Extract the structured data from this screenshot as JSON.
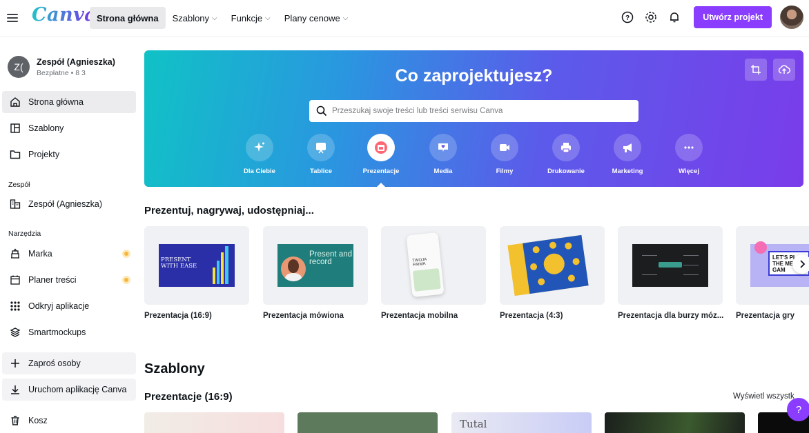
{
  "brand": {
    "logo": "Canva",
    "accent": "#8b3dff"
  },
  "topnav": {
    "items": [
      {
        "label": "Strona główna",
        "active": true
      },
      {
        "label": "Szablony",
        "caret": true
      },
      {
        "label": "Funkcje",
        "caret": true
      },
      {
        "label": "Plany cenowe",
        "caret": true
      }
    ],
    "create_label": "Utwórz projekt",
    "icons": [
      "help-icon",
      "gear-icon",
      "bell-icon"
    ]
  },
  "sidebar": {
    "team_initials": "Z(",
    "team_name": "Zespół (Agnieszka)",
    "team_sub": "Bezpłatne • 8 3",
    "items": [
      {
        "label": "Strona główna",
        "icon": "home-icon"
      },
      {
        "label": "Szablony",
        "icon": "templates-icon"
      },
      {
        "label": "Projekty",
        "icon": "folder-icon"
      }
    ],
    "team_section": "Zespół",
    "team_item": "Zespół (Agnieszka)",
    "tools_section": "Narzędzia",
    "tools": [
      {
        "label": "Marka",
        "icon": "brand-icon",
        "badge": true
      },
      {
        "label": "Planer treści",
        "icon": "calendar-icon",
        "badge": true
      },
      {
        "label": "Odkryj aplikacje",
        "icon": "apps-grid-icon"
      },
      {
        "label": "Smartmockups",
        "icon": "mockups-icon"
      }
    ],
    "invite": "Zaproś osoby",
    "launch_app": "Uruchom aplikację Canva",
    "trash": "Kosz"
  },
  "hero": {
    "title": "Co zaprojektujesz?",
    "search_placeholder": "Przeszukaj swoje treści lub treści serwisu Canva",
    "categories": [
      {
        "label": "Dla Ciebie",
        "icon": "sparkle-icon"
      },
      {
        "label": "Tablice",
        "icon": "whiteboard-icon"
      },
      {
        "label": "Prezentacje",
        "icon": "presentation-icon",
        "active": true
      },
      {
        "label": "Media",
        "icon": "social-media-icon"
      },
      {
        "label": "Filmy",
        "icon": "video-icon"
      },
      {
        "label": "Drukowanie",
        "icon": "print-icon"
      },
      {
        "label": "Marketing",
        "icon": "megaphone-icon"
      },
      {
        "label": "Więcej",
        "icon": "more-icon"
      }
    ]
  },
  "present_section": {
    "title": "Prezentuj, nagrywaj, udostępniaj...",
    "cards": [
      {
        "label": "Prezentacja (16:9)",
        "thumb_text": "PRESENT WITH EASE"
      },
      {
        "label": "Prezentacja mówiona",
        "thumb_text": "Present and record"
      },
      {
        "label": "Prezentacja mobilna",
        "thumb_text": "TWOJA FIRMA"
      },
      {
        "label": "Prezentacja (4:3)"
      },
      {
        "label": "Prezentacja dla burzy móz..."
      },
      {
        "label": "Prezentacja gry",
        "thumb_text": "LET'S PL THE ME GAM"
      }
    ]
  },
  "templates_section": {
    "title": "Szablony",
    "subtitle": "Prezentacje (16:9)",
    "view_all": "Wyświetl wszystk",
    "preview_text": "Tutal"
  },
  "help_label": "?"
}
